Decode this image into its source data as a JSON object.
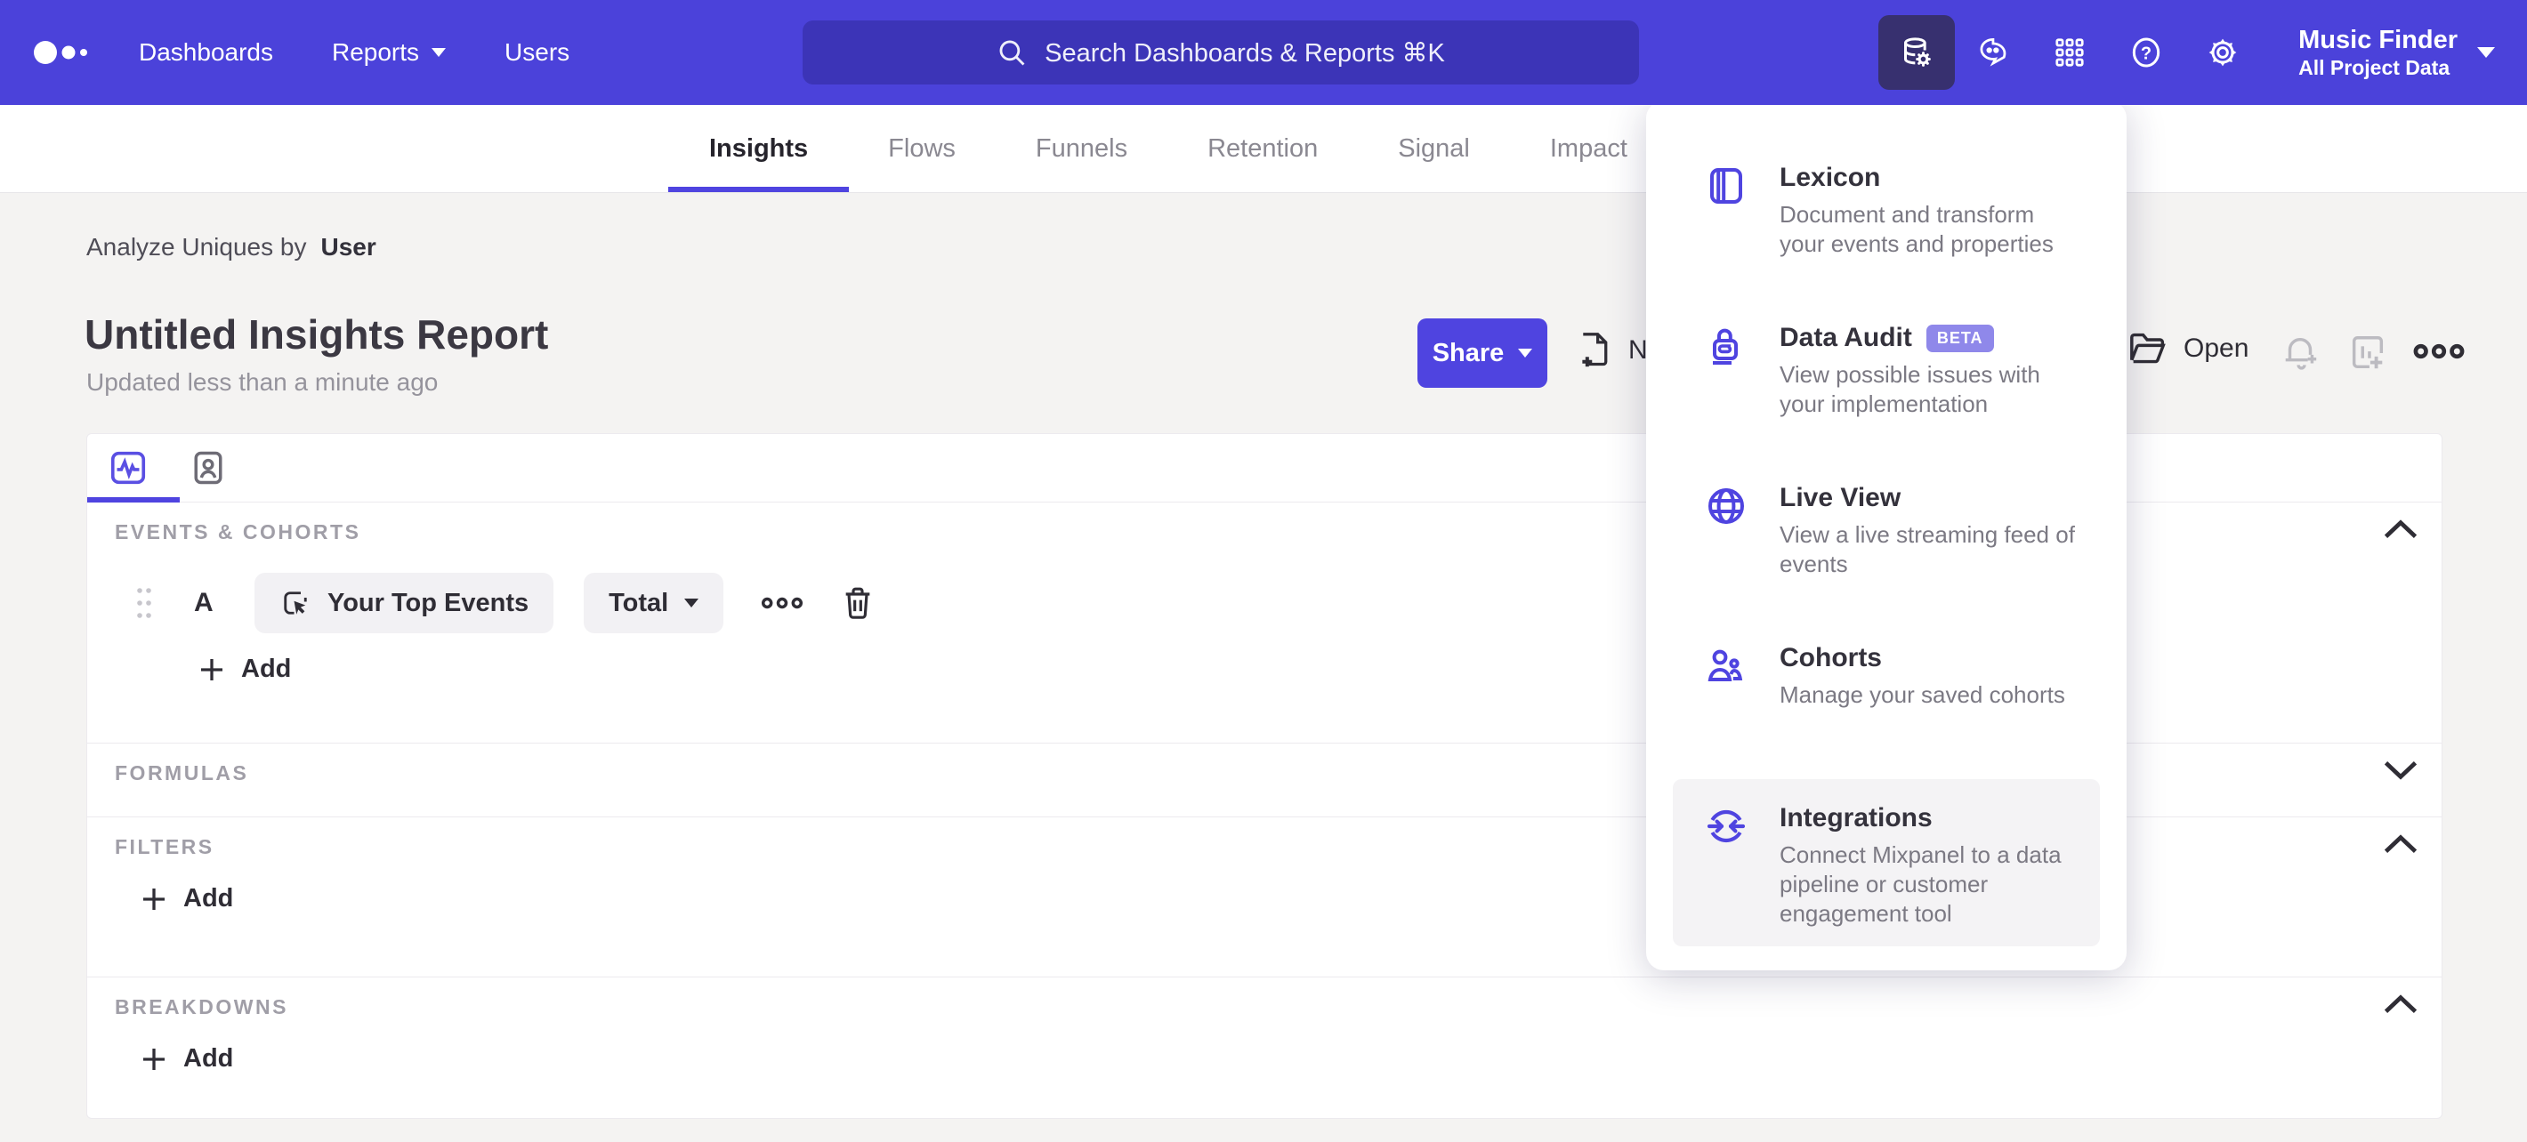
{
  "header": {
    "nav": [
      {
        "label": "Dashboards"
      },
      {
        "label": "Reports"
      },
      {
        "label": "Users"
      }
    ],
    "search_placeholder": "Search Dashboards & Reports ⌘K",
    "project": {
      "name": "Music Finder",
      "scope": "All Project Data"
    }
  },
  "tabs": [
    {
      "label": "Insights",
      "active": true
    },
    {
      "label": "Flows"
    },
    {
      "label": "Funnels"
    },
    {
      "label": "Retention"
    },
    {
      "label": "Signal"
    },
    {
      "label": "Impact"
    }
  ],
  "report": {
    "analyze_prefix": "Analyze Uniques by",
    "analyze_entity": "User",
    "title": "Untitled Insights Report",
    "updated": "Updated less than a minute ago"
  },
  "toolbar": {
    "share_label": "Share",
    "new_label": "New",
    "open_label": "Open"
  },
  "menu": {
    "items": [
      {
        "title": "Lexicon",
        "description": "Document and transform your events and properties"
      },
      {
        "title": "Data Audit",
        "badge": "BETA",
        "description": "View possible issues with your implementation"
      },
      {
        "title": "Live View",
        "description": "View a live streaming feed of events"
      },
      {
        "title": "Cohorts",
        "description": "Manage your saved cohorts"
      },
      {
        "title": "Integrations",
        "description": "Connect Mixpanel to a data pipeline or customer engagement tool",
        "highlighted": true
      }
    ]
  },
  "builder": {
    "sections": {
      "events": "EVENTS & COHORTS",
      "formulas": "FORMULAS",
      "filters": "FILTERS",
      "breakdowns": "BREAKDOWNS"
    },
    "event_row": {
      "series_label": "A",
      "event_name": "Your Top Events",
      "metric": "Total"
    },
    "add_label": "Add"
  },
  "colors": {
    "topbar": "#4b42da",
    "topbar_active_icon_bg": "#37306f",
    "accent": "#4f44e0",
    "beta_badge": "#8f88ea",
    "text_dark": "#34323c",
    "text_gray": "#7b7983",
    "content_bg": "#f4f3f2"
  }
}
